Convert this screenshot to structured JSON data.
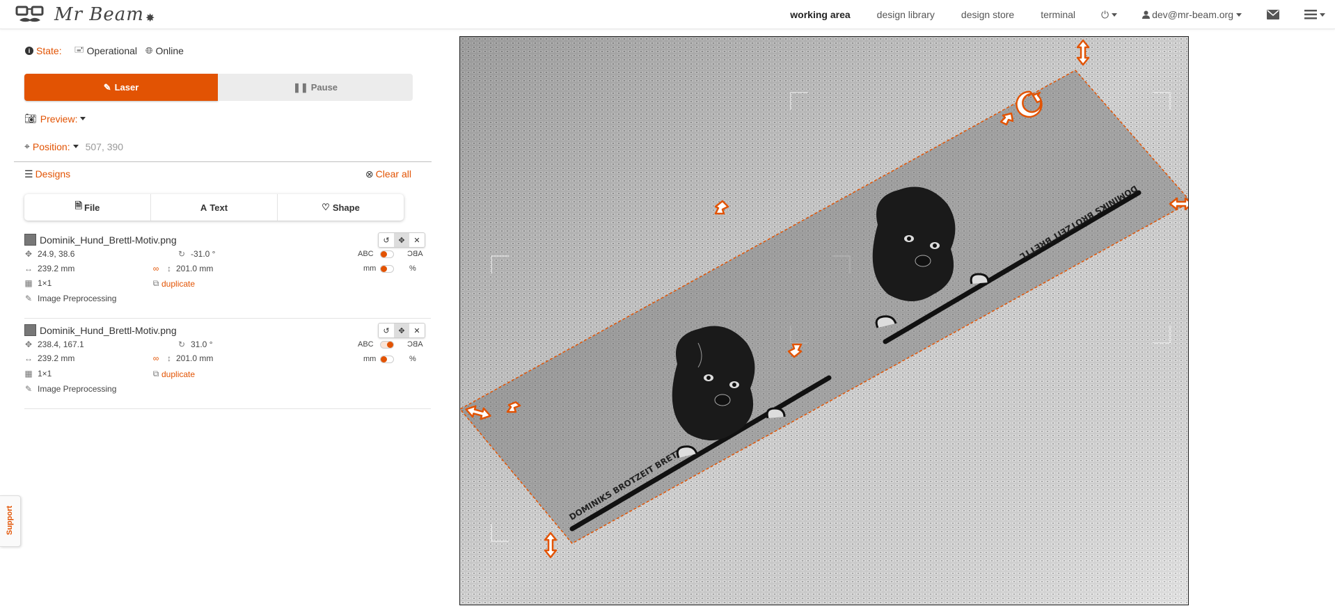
{
  "navbar": {
    "logo_text": "Mr Beam",
    "links": [
      "working area",
      "design library",
      "design store",
      "terminal"
    ],
    "power_label": "⏻",
    "user": "dev@mr-beam.org",
    "mail_icon": "envelope-icon",
    "menu_icon": "hamburger-icon"
  },
  "state": {
    "label": "State:",
    "operational": "Operational",
    "online": "Online"
  },
  "controls": {
    "laser_label": "Laser",
    "pause_label": "Pause"
  },
  "preview": {
    "label": "Preview:"
  },
  "position": {
    "label": "Position:",
    "value": "507, 390"
  },
  "designs": {
    "label": "Designs",
    "clear_all": "Clear all",
    "add_file": "File",
    "add_text": "Text",
    "add_shape": "Shape",
    "items": [
      {
        "name": "Dominik_Hund_Brettl-Motiv.png",
        "position": "24.9, 38.6",
        "rotation": "-31.0 °",
        "width": "239.2 mm",
        "height": "201.0 mm",
        "grid": "1×1",
        "duplicate": "duplicate",
        "preprocess": "Image Preprocessing",
        "mirror_label": "ABC",
        "unit_label": "mm",
        "percent_label": "%",
        "mirror_on": false,
        "unit_on": false
      },
      {
        "name": "Dominik_Hund_Brettl-Motiv.png",
        "position": "238.4, 167.1",
        "rotation": "31.0 °",
        "width": "239.2 mm",
        "height": "201.0 mm",
        "grid": "1×1",
        "duplicate": "duplicate",
        "preprocess": "Image Preprocessing",
        "mirror_label": "ABC",
        "unit_label": "mm",
        "percent_label": "%",
        "mirror_on": true,
        "unit_on": false
      }
    ]
  },
  "board": {
    "text_left": "DOMINIKS BROTZEIT BRETTL",
    "text_right": "DOMINIKS BROTZEIT BRETTL"
  },
  "support": {
    "label": "Support"
  },
  "colors": {
    "accent": "#e25303"
  }
}
